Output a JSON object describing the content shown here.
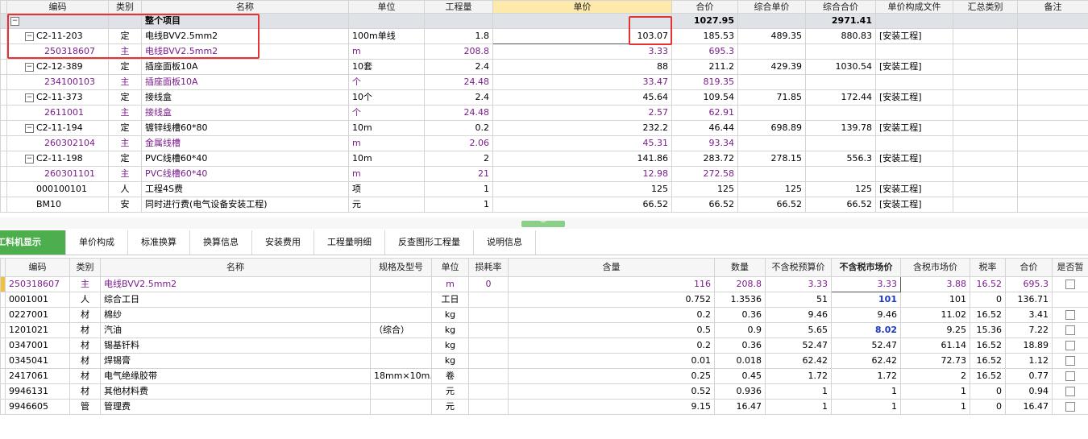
{
  "top": {
    "headers": [
      "编码",
      "类别",
      "名称",
      "单位",
      "工程量",
      "单价",
      "合价",
      "综合单价",
      "综合合价",
      "单价构成文件",
      "汇总类别",
      "备注"
    ],
    "summary": {
      "name": "整个项目",
      "total": "1027.95",
      "combo_total": "2971.41"
    },
    "rows": [
      {
        "code": "C2-11-203",
        "type": "定",
        "name": "电线BVV2.5mm2",
        "unit": "100m单线",
        "qty": "1.8",
        "price": "103.07",
        "total": "185.53",
        "cunit": "489.35",
        "ctotal": "880.83",
        "file": "[安装工程]",
        "sub": false
      },
      {
        "code": "25031860​7",
        "type": "主",
        "name": "电线BVV2.5mm2",
        "unit": "m",
        "qty": "208.8",
        "price": "3.33",
        "total": "695.3",
        "cunit": "",
        "ctotal": "",
        "file": "",
        "sub": true
      },
      {
        "code": "C2-12-389",
        "type": "定",
        "name": "插座面板10A",
        "unit": "10套",
        "qty": "2.4",
        "price": "88",
        "total": "211.2",
        "cunit": "429.39",
        "ctotal": "1030.54",
        "file": "[安装工程]",
        "sub": false
      },
      {
        "code": "234100103",
        "type": "主",
        "name": "插座面板10A",
        "unit": "个",
        "qty": "24.48",
        "price": "33.47",
        "total": "819.35",
        "cunit": "",
        "ctotal": "",
        "file": "",
        "sub": true
      },
      {
        "code": "C2-11-373",
        "type": "定",
        "name": "接线盒",
        "unit": "10个",
        "qty": "2.4",
        "price": "45.64",
        "total": "109.54",
        "cunit": "71.85",
        "ctotal": "172.44",
        "file": "[安装工程]",
        "sub": false
      },
      {
        "code": "2611001",
        "type": "主",
        "name": "接线盒",
        "unit": "个",
        "qty": "24.48",
        "price": "2.57",
        "total": "62.91",
        "cunit": "",
        "ctotal": "",
        "file": "",
        "sub": true
      },
      {
        "code": "C2-11-194",
        "type": "定",
        "name": "镀锌线槽60*80",
        "unit": "10m",
        "qty": "0.2",
        "price": "232.2",
        "total": "46.44",
        "cunit": "698.89",
        "ctotal": "139.78",
        "file": "[安装工程]",
        "sub": false
      },
      {
        "code": "260302104",
        "type": "主",
        "name": "金属线槽",
        "unit": "m",
        "qty": "2.06",
        "price": "45.31",
        "total": "93.34",
        "cunit": "",
        "ctotal": "",
        "file": "",
        "sub": true
      },
      {
        "code": "C2-11-198",
        "type": "定",
        "name": "PVC线槽60*40",
        "unit": "10m",
        "qty": "2",
        "price": "141.86",
        "total": "283.72",
        "cunit": "278.15",
        "ctotal": "556.3",
        "file": "[安装工程]",
        "sub": false
      },
      {
        "code": "260301101",
        "type": "主",
        "name": "PVC线槽60*40",
        "unit": "m",
        "qty": "21",
        "price": "12.98",
        "total": "272.58",
        "cunit": "",
        "ctotal": "",
        "file": "",
        "sub": true
      },
      {
        "code": "000100101",
        "type": "人",
        "name": "工程4S费",
        "unit": "项",
        "qty": "1",
        "price": "125",
        "total": "125",
        "cunit": "125",
        "ctotal": "125",
        "file": "[安装工程]",
        "sub": false
      },
      {
        "code": "BM10",
        "type": "安",
        "name": "同时进行费(电气设备安装工程)",
        "unit": "元",
        "qty": "1",
        "price": "66.52",
        "total": "66.52",
        "cunit": "66.52",
        "ctotal": "66.52",
        "file": "[安装工程]",
        "sub": false
      }
    ]
  },
  "tabs": [
    "工料机显示",
    "单价构成",
    "标准换算",
    "换算信息",
    "安装费用",
    "工程量明细",
    "反查图形工程量",
    "说明信息"
  ],
  "bottom": {
    "headers": [
      "编码",
      "类别",
      "名称",
      "规格及型号",
      "单位",
      "损耗率",
      "含量",
      "数量",
      "不含税预算价",
      "不含税市场价",
      "含税市场价",
      "税率",
      "合价",
      "是否暂"
    ],
    "rows": [
      {
        "code": "250318607",
        "type": "主",
        "name": "电线BVV2.5mm2",
        "spec": "",
        "unit": "m",
        "loss": "0",
        "content": "116",
        "amount": "208.8",
        "budget": "3.33",
        "market": "3.33",
        "taxmarket": "3.88",
        "rate": "16.52",
        "total": "695.3",
        "purple": true,
        "blue": false,
        "cb": true
      },
      {
        "code": "0001001",
        "type": "人",
        "name": "综合工日",
        "spec": "",
        "unit": "工日",
        "loss": "",
        "content": "0.752",
        "amount": "1.3536",
        "budget": "51",
        "market": "101",
        "taxmarket": "101",
        "rate": "0",
        "total": "136.71",
        "purple": false,
        "blue": true,
        "cb": false
      },
      {
        "code": "0227001",
        "type": "材",
        "name": "棉纱",
        "spec": "",
        "unit": "kg",
        "loss": "",
        "content": "0.2",
        "amount": "0.36",
        "budget": "9.46",
        "market": "9.46",
        "taxmarket": "11.02",
        "rate": "16.52",
        "total": "3.41",
        "purple": false,
        "blue": false,
        "cb": true
      },
      {
        "code": "1201021",
        "type": "材",
        "name": "汽油",
        "spec": "（综合）",
        "unit": "kg",
        "loss": "",
        "content": "0.5",
        "amount": "0.9",
        "budget": "5.65",
        "market": "8.02",
        "taxmarket": "9.25",
        "rate": "15.36",
        "total": "7.22",
        "purple": false,
        "blue": true,
        "cb": true
      },
      {
        "code": "0347001",
        "type": "材",
        "name": "锡基钎料",
        "spec": "",
        "unit": "kg",
        "loss": "",
        "content": "0.2",
        "amount": "0.36",
        "budget": "52.47",
        "market": "52.47",
        "taxmarket": "61.14",
        "rate": "16.52",
        "total": "18.89",
        "purple": false,
        "blue": false,
        "cb": true
      },
      {
        "code": "0345041",
        "type": "材",
        "name": "焊锡膏",
        "spec": "",
        "unit": "kg",
        "loss": "",
        "content": "0.01",
        "amount": "0.018",
        "budget": "62.42",
        "market": "62.42",
        "taxmarket": "72.73",
        "rate": "16.52",
        "total": "1.12",
        "purple": false,
        "blue": false,
        "cb": true
      },
      {
        "code": "2417061",
        "type": "材",
        "name": "电气绝缘胶带",
        "spec": "18mm×10m…",
        "unit": "卷",
        "loss": "",
        "content": "0.25",
        "amount": "0.45",
        "budget": "1.72",
        "market": "1.72",
        "taxmarket": "2",
        "rate": "16.52",
        "total": "0.77",
        "purple": false,
        "blue": false,
        "cb": true
      },
      {
        "code": "9946131",
        "type": "材",
        "name": "其他材料费",
        "spec": "",
        "unit": "元",
        "loss": "",
        "content": "0.52",
        "amount": "0.936",
        "budget": "1",
        "market": "1",
        "taxmarket": "1",
        "rate": "0",
        "total": "0.94",
        "purple": false,
        "blue": false,
        "cb": true
      },
      {
        "code": "9946605",
        "type": "管",
        "name": "管理费",
        "spec": "",
        "unit": "元",
        "loss": "",
        "content": "9.15",
        "amount": "16.47",
        "budget": "1",
        "market": "1",
        "taxmarket": "1",
        "rate": "0",
        "total": "16.47",
        "purple": false,
        "blue": false,
        "cb": true
      }
    ]
  },
  "colors": {
    "accent_green": "#4cae4c",
    "highlight_col": "#fde9a9",
    "sub_item_purple": "#7b1d8c",
    "annotation_red": "#e53333",
    "summary_row": "#dfe3e8"
  },
  "icons": {
    "collapse": "minus-box-icon",
    "checkbox": "checkbox-icon"
  }
}
